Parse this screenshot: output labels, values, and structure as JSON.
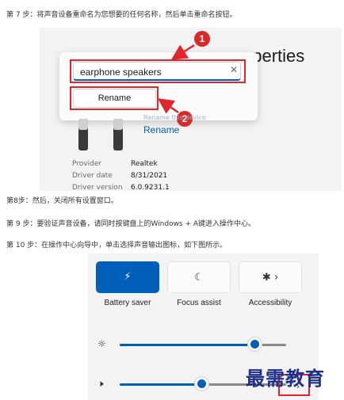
{
  "steps": {
    "step7": "第 7 步：将声音设备重命名为您想要的任何名称，然后单击重命名按钮。",
    "step8": "第8步：然后，关闭所有设置窗口。",
    "step9": "第 9 步：要验证声音设备，请同时按键盘上的Windows + A键进入操作中心。",
    "step10": "第 10 步：在操作中心向导中，单击选择声音输出图标，如下图所示。"
  },
  "rename_dialog": {
    "window_title": "operties",
    "input_value": "earphone speakers",
    "clear_icon": "close-icon",
    "rename_button": "Rename",
    "rename_link": "Rename",
    "callout_1": "1",
    "callout_2": "2",
    "faded_text": "Rename this device"
  },
  "device_info": {
    "rows": [
      {
        "label": "Provider",
        "value": "Realtek"
      },
      {
        "label": "Driver date",
        "value": "8/31/2021"
      },
      {
        "label": "Driver version",
        "value": "6.0.9231.1"
      }
    ]
  },
  "action_center": {
    "tiles": [
      {
        "label": "Battery saver",
        "icon": "battery-saver-icon",
        "active": true
      },
      {
        "label": "Focus assist",
        "icon": "moon-icon",
        "active": false
      },
      {
        "label": "Accessibility",
        "icon": "accessibility-icon",
        "active": false
      }
    ],
    "brightness_level": 0.81,
    "volume_level": 0.49,
    "brightness_icon": "sun-icon",
    "volume_icon": "speaker-icon",
    "output_icon": "sound-output-icon"
  },
  "watermark": "最需教育",
  "colors": {
    "accent": "#005fb8",
    "annotation_red": "#e0262b"
  }
}
